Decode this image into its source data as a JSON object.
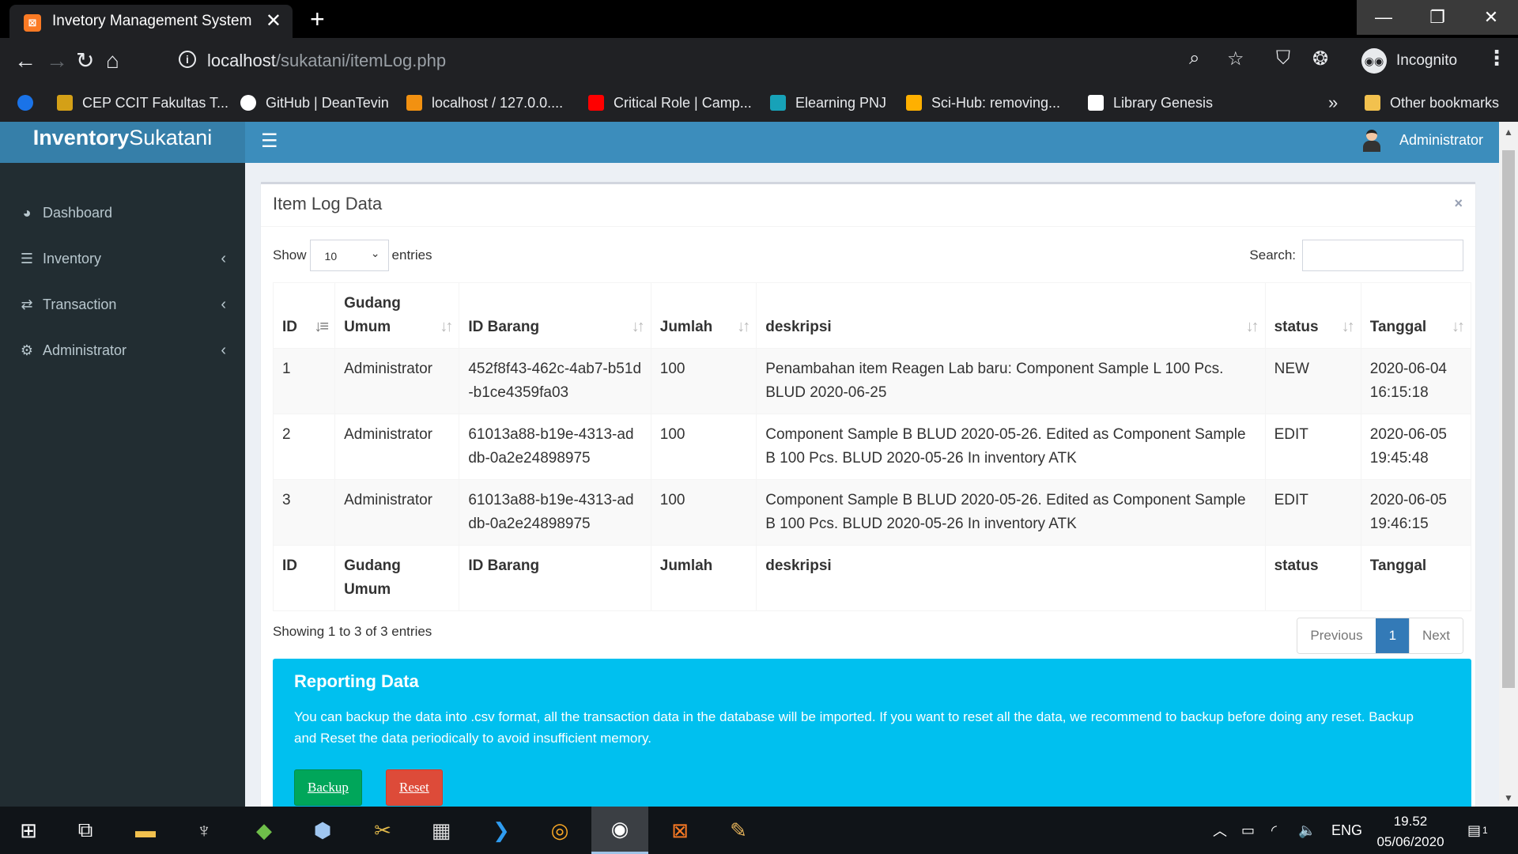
{
  "browser": {
    "tab_title": "Invetory Management System",
    "tab_close": "✕",
    "new_tab": "+",
    "url_host": "localhost",
    "url_path": "/sukatani/itemLog.php",
    "profile_label": "Incognito",
    "bookmarks": [
      {
        "label": "CEP CCIT Fakultas T...",
        "color": "#d4a017"
      },
      {
        "label": "GitHub | DeanTevin",
        "color": "#ffffff"
      },
      {
        "label": "localhost / 127.0.0....",
        "color": "#f29111"
      },
      {
        "label": "Critical Role | Camp...",
        "color": "#ff0000"
      },
      {
        "label": "Elearning PNJ",
        "color": "#17a2b8"
      },
      {
        "label": "Sci-Hub: removing...",
        "color": "#ffb000"
      },
      {
        "label": "Library Genesis",
        "color": "#ffffff"
      }
    ],
    "bookmarks_overflow": "»",
    "other_bookmarks": "Other bookmarks"
  },
  "app": {
    "logo_bold": "Inventory",
    "logo_light": "Sukatani",
    "user_name": "Administrator",
    "sidebar": [
      {
        "label": "Dashboard",
        "icon": "dashboard-icon",
        "glyph": "◕",
        "has_chevron": false
      },
      {
        "label": "Inventory",
        "icon": "database-icon",
        "glyph": "☰",
        "has_chevron": true
      },
      {
        "label": "Transaction",
        "icon": "exchange-icon",
        "glyph": "⇄",
        "has_chevron": true
      },
      {
        "label": "Administrator",
        "icon": "cogs-icon",
        "glyph": "⚙",
        "has_chevron": true
      }
    ]
  },
  "box": {
    "title": "Item Log Data",
    "close": "×"
  },
  "datatable": {
    "show_label": "Show",
    "page_length": "10",
    "entries_label": "entries",
    "search_label": "Search:",
    "search_value": "",
    "columns": [
      "ID",
      "Gudang Umum",
      "ID Barang",
      "Jumlah",
      "deskripsi",
      "status",
      "Tanggal"
    ],
    "rows": [
      [
        "1",
        "Administrator",
        "452f8f43-462c-4ab7-b51d-b1ce4359fa03",
        "100",
        "Penambahan item Reagen Lab baru: Component Sample L 100 Pcs. BLUD 2020-06-25",
        "NEW",
        "2020-06-04 16:15:18"
      ],
      [
        "2",
        "Administrator",
        "61013a88-b19e-4313-addb-0a2e24898975",
        "100",
        "Component Sample B BLUD 2020-05-26. Edited as Component Sample B 100 Pcs. BLUD 2020-05-26 In inventory ATK",
        "EDIT",
        "2020-06-05 19:45:48"
      ],
      [
        "3",
        "Administrator",
        "61013a88-b19e-4313-addb-0a2e24898975",
        "100",
        "Component Sample B BLUD 2020-05-26. Edited as Component Sample B 100 Pcs. BLUD 2020-05-26 In inventory ATK",
        "EDIT",
        "2020-06-05 19:46:15"
      ]
    ],
    "info": "Showing 1 to 3 of 3 entries",
    "pagination": {
      "previous": "Previous",
      "current": "1",
      "next": "Next"
    }
  },
  "reporting": {
    "title": "Reporting Data",
    "text": "You can backup the data into .csv format, all the transaction data in the database will be imported. If you want to reset all the data, we recommend to backup before doing any reset. Backup and Reset the data periodically to avoid insufficient memory.",
    "backup_label": "Backup",
    "reset_label": "Reset"
  },
  "taskbar": {
    "language": "ENG",
    "time": "19.52",
    "date": "05/06/2020",
    "notification_count": "1"
  },
  "colors": {
    "header": "#3c8dbc",
    "logo_bg": "#367fa9",
    "sidebar": "#222d32",
    "callout": "#00c0ef",
    "backup": "#00a65a",
    "reset": "#dd4b39",
    "page_active": "#337ab7"
  }
}
